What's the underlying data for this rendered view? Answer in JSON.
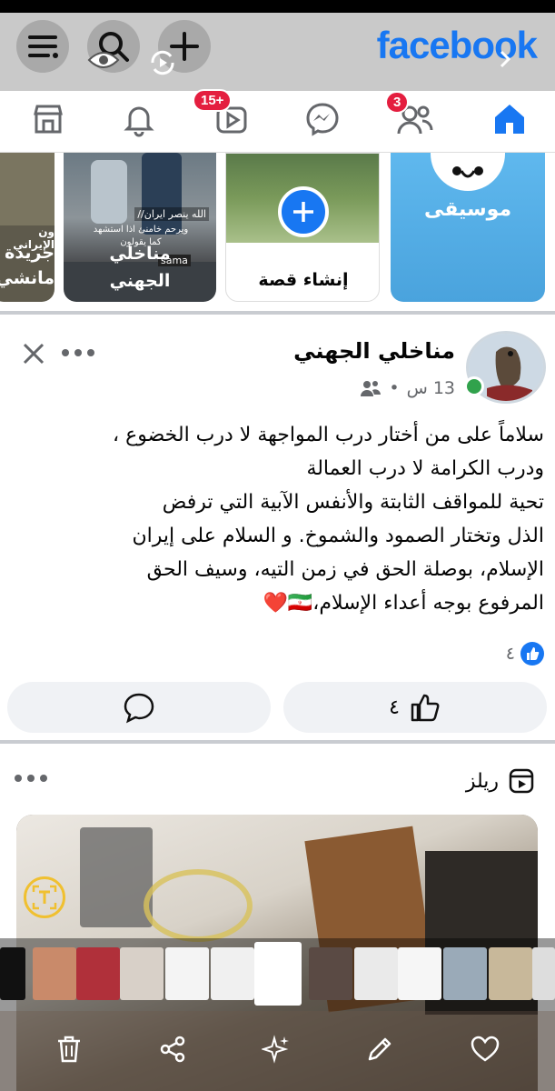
{
  "header": {
    "logo": "facebook",
    "icons": [
      "menu-icon",
      "search-icon",
      "add-icon",
      "eye-icon",
      "sync-icon",
      "chevron-right-icon"
    ]
  },
  "nav": {
    "items": [
      {
        "name": "home",
        "icon": "home-icon",
        "active": true
      },
      {
        "name": "friends",
        "icon": "friends-icon",
        "badge": "3"
      },
      {
        "name": "messenger",
        "icon": "messenger-icon"
      },
      {
        "name": "video",
        "icon": "video-icon",
        "badge": "15+"
      },
      {
        "name": "notifications",
        "icon": "bell-icon"
      },
      {
        "name": "marketplace",
        "icon": "store-icon"
      }
    ],
    "colors": {
      "active": "#1877f2",
      "badge": "#e41e3f"
    }
  },
  "stories": {
    "music_label": "موسيقى",
    "create_label": "إنشاء قصة",
    "story_user_label": "مناخلي\nالجهني",
    "story_caption_1": "الله ينصر ايران//",
    "story_caption_2": "ويرحم خامنئ اذا استشهد\nكما يقولون",
    "story_watermark": "sama",
    "partial_label": "جريدة\nمانشي",
    "partial_caption": "ون الإيراني"
  },
  "post": {
    "author": "مناخلي الجهني",
    "time": "13 س",
    "separator": "•",
    "text": "سلاماً على من أختار درب المواجهة لا درب الخضوع ،\nودرب الكرامة لا درب العمالة\n تحية  للمواقف الثابتة والأنفس الآبية التي ترفض\nالذل وتختار الصمود والشموخ. و السلام على إيران\nالإسلام، بوصلة الحق في زمن التيه، وسيف الحق\nالمرفوع بوجه أعداء الإسلام،🇮🇷❤️",
    "reaction_count": "٤",
    "like_count": "٤"
  },
  "reels": {
    "title": "ريلز"
  },
  "gallery": {
    "actions": [
      "delete-icon",
      "share-icon",
      "sparkle-icon",
      "edit-icon",
      "heart-icon"
    ],
    "thumb_count": 15
  }
}
